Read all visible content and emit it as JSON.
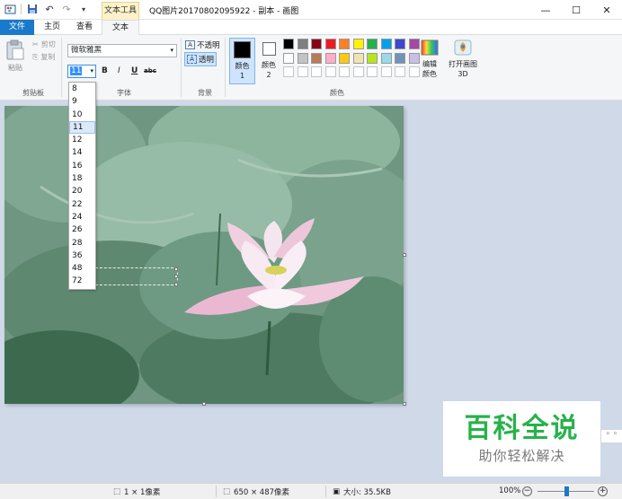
{
  "app": {
    "title": "QQ图片20170802095922 - 副本 - 画图",
    "context_tab": "文本工具"
  },
  "window": {
    "minimize": "—",
    "maximize": "☐",
    "close": "✕"
  },
  "tabs": {
    "file": "文件",
    "home": "主页",
    "view": "查看",
    "text": "文本"
  },
  "clipboard": {
    "paste": "粘贴",
    "cut": "剪切",
    "copy": "复制",
    "label": "剪贴板"
  },
  "font": {
    "family": "微软雅黑",
    "size": "11",
    "bold": "B",
    "italic": "I",
    "underline": "U",
    "strike": "abc",
    "label": "字体"
  },
  "background": {
    "opaque": "不透明",
    "transparent": "透明",
    "label": "背景"
  },
  "colors": {
    "color1_label": "颜色 1",
    "color2_label": "颜色 2",
    "edit_label": "编辑颜色",
    "paint3d_label": "打开画图 3D",
    "label": "颜色",
    "color1": "#000000",
    "color2": "#ffffff",
    "row1": [
      "#000000",
      "#7f7f7f",
      "#880015",
      "#ed1c24",
      "#ff7f27",
      "#fff200",
      "#22b14c",
      "#00a2e8",
      "#3f48cc",
      "#a349a4"
    ],
    "row2": [
      "#ffffff",
      "#c3c3c3",
      "#b97a57",
      "#ffaec9",
      "#ffc90e",
      "#efe4b0",
      "#b5e61d",
      "#99d9ea",
      "#7092be",
      "#c8bfe7"
    ]
  },
  "font_sizes": [
    "8",
    "9",
    "10",
    "11",
    "12",
    "14",
    "16",
    "18",
    "20",
    "22",
    "24",
    "26",
    "28",
    "36",
    "48",
    "72"
  ],
  "font_size_selected": "11",
  "status": {
    "selection": "1 × 1像素",
    "image_size": "650 × 487像素",
    "file_size": "大小: 35.5KB",
    "zoom": "100%",
    "zoom_level": 0.5
  },
  "watermark": {
    "title": "百科全说",
    "subtitle": "助你轻松解决"
  },
  "theme": {
    "file_tab": "#1979ca",
    "accent": "#1979ca"
  }
}
